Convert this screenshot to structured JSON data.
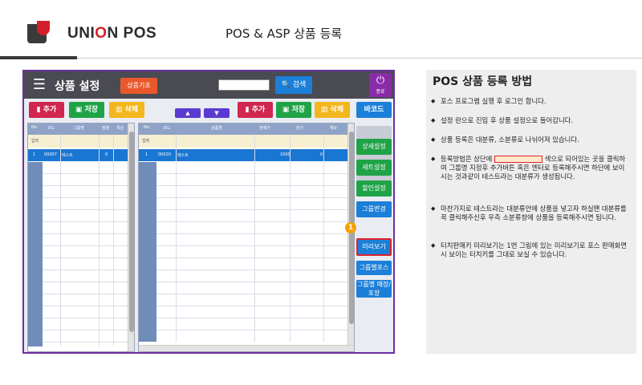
{
  "header": {
    "brand_part1": "UNI",
    "brand_accent": "O",
    "brand_part2": "N POS",
    "title": "POS & ASP 상품 등록"
  },
  "app": {
    "title": "상품 설정",
    "base_button": "상품기초",
    "search_button": "검색",
    "end_button": "종료",
    "left_toolbar": {
      "add": "추가",
      "save": "저장",
      "delete": "삭제"
    },
    "right_toolbar": {
      "add": "추가",
      "save": "저장",
      "delete": "삭제",
      "barcode": "바코드"
    },
    "left_grid": {
      "headers": [
        "No",
        "코드",
        "그룹명",
        "정렬",
        "색상"
      ],
      "input_label": "입력",
      "selected_row": [
        "1",
        "00007",
        "테스트",
        "0",
        ""
      ]
    },
    "right_grid": {
      "headers": [
        "No",
        "코드",
        "상품명",
        "판매가",
        "원가",
        "재뉴"
      ],
      "input_label": "입력",
      "selected_row": [
        "1",
        "00020",
        "테스트",
        "1000",
        "0",
        ""
      ]
    },
    "side_buttons": [
      "상세설정",
      "세트설정",
      "할인설정",
      "그룹변경",
      "미리보기",
      "그룹별포스",
      "그룹별 매장/포장"
    ],
    "badge": "1",
    "colors": {
      "border": "#6b2e9e",
      "selected_row": "#1976d2",
      "highlight": "#e0202c"
    }
  },
  "panel": {
    "title": "POS 상품 등록 방법",
    "items": [
      "포스 프로그램 실행 후 로그인 합니다.",
      "설정 란으로 진입 후 상품 설정으로 들어갑니다.",
      "상품 등록은 대분류, 소분류로 나뉘어져 있습니다.",
      "등록방법은 상단에",
      "색으로 되어있는 곳을 클릭하여 그룹명 지정후 추가버튼 혹은 엔터로 등록해주시면 하단에 보이시는 것과같이 테스트라는 대분류가 생성됩니다.",
      "마찬가지로 테스트라는 대분류안에 상품을 넣고자 하실땐 대분류를 꼭 클릭해주신후 우측 소분류창에 상품을 등록해주시면 됩니다.",
      "터치판매키 미리보기는 1번 그림에 있는 미리보기로 포스 판매화면시 보이는 터치키를 그대로 보실 수 있습니다."
    ]
  }
}
